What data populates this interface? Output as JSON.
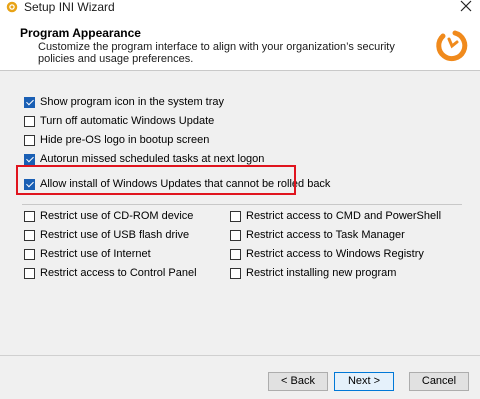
{
  "window": {
    "title": "Setup INI Wizard"
  },
  "header": {
    "title": "Program Appearance",
    "subtitle": "Customize the program interface to align with your organization’s security policies and usage preferences."
  },
  "options_top": [
    {
      "label": "Show program icon in the system tray",
      "checked": true
    },
    {
      "label": "Turn off automatic Windows Update",
      "checked": false
    },
    {
      "label": "Hide pre-OS logo in bootup screen",
      "checked": false
    },
    {
      "label": "Autorun missed scheduled tasks at next logon",
      "checked": true
    },
    {
      "label": "Allow install of Windows Updates that cannot be rolled back",
      "checked": true
    }
  ],
  "restrictions_left": [
    {
      "label": "Restrict use of CD-ROM device",
      "checked": false
    },
    {
      "label": "Restrict use of USB flash drive",
      "checked": false
    },
    {
      "label": "Restrict use of Internet",
      "checked": false
    },
    {
      "label": "Restrict access to Control Panel",
      "checked": false
    }
  ],
  "restrictions_right": [
    {
      "label": "Restrict access to CMD and PowerShell",
      "checked": false
    },
    {
      "label": "Restrict access to Task Manager",
      "checked": false
    },
    {
      "label": "Restrict access to Windows Registry",
      "checked": false
    },
    {
      "label": "Restrict installing new program",
      "checked": false
    }
  ],
  "buttons": {
    "back": "< Back",
    "next": "Next >",
    "cancel": "Cancel"
  },
  "colors": {
    "accent": "#1a5fb4",
    "highlight": "#e0141e",
    "logo": "#f08a1c"
  }
}
